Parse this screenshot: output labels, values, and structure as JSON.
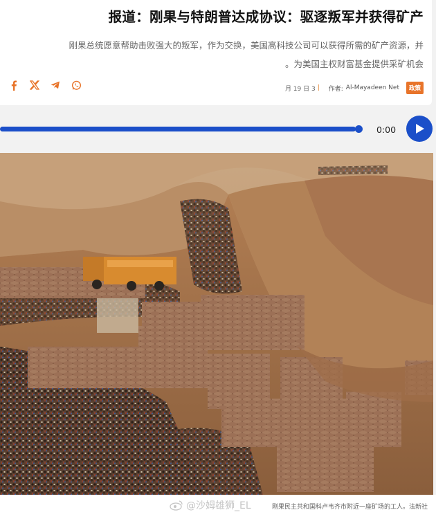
{
  "article": {
    "title": "报道：刚果与特朗普达成协议：驱逐叛军并获得矿产",
    "summary_line1": "刚果总统愿意帮助击败强大的叛军，作为交换，美国高科技公司可以获得所需的矿产资源，并",
    "summary_line2": "。为美国主权财富基金提供采矿机会"
  },
  "share": {
    "icons": [
      "facebook-icon",
      "x-icon",
      "telegram-icon",
      "whatsapp-icon"
    ]
  },
  "meta": {
    "date": "月 19 日 3",
    "separator": "|",
    "author_label": "作者:",
    "author": "Al-Mayadeen Net",
    "category": "政策"
  },
  "audio": {
    "time": "0:00",
    "progress": 0.99
  },
  "photo": {
    "caption": "刚果民主共和国科卢韦齐市附近一座矿场的工人。法新社",
    "watermark": "@沙姆雄狮_EL"
  },
  "colors": {
    "accent": "#1b4fc9",
    "badge": "#e8742a",
    "social": "#e8742a"
  }
}
